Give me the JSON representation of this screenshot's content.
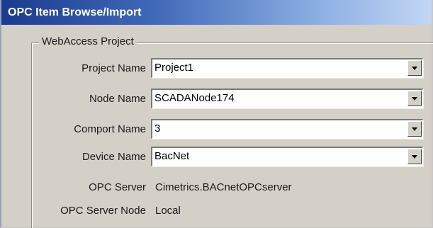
{
  "window": {
    "title": "OPC Item Browse/Import"
  },
  "group": {
    "label": "WebAccess Project"
  },
  "fields": [
    {
      "label": "Project Name",
      "value": "Project1"
    },
    {
      "label": "Node Name",
      "value": "SCADANode174"
    },
    {
      "label": "Comport Name",
      "value": "3"
    },
    {
      "label": "Device Name",
      "value": "BacNet"
    }
  ],
  "info": [
    {
      "label": "OPC Server",
      "value": "Cimetrics.BACnetOPCserver"
    },
    {
      "label": "OPC Server Node",
      "value": "Local"
    }
  ],
  "icons": {
    "dropdown": "chevron-down-icon"
  }
}
